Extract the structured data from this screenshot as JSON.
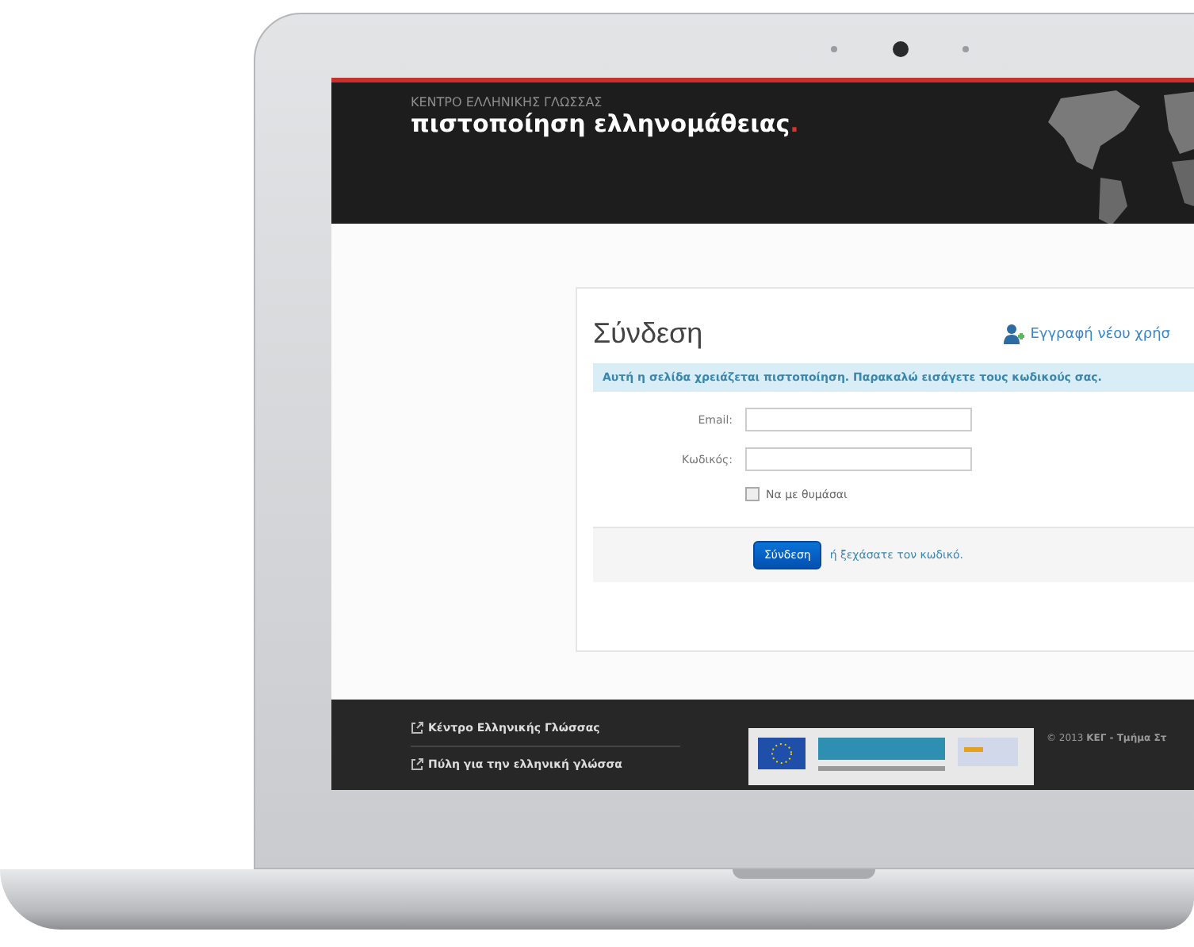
{
  "header": {
    "subtitle": "ΚΕΝΤΡΟ ΕΛΛΗΝΙΚΗΣ ΓΛΩΣΣΑΣ",
    "title": "πιστοποίηση ελληνομάθειας",
    "title_mark": "."
  },
  "login": {
    "heading": "Σύνδεση",
    "register_link": "Εγγραφή νέου χρήσ",
    "notice": "Αυτή η σελίδα χρειάζεται πιστοποίηση. Παρακαλώ εισάγετε τους κωδικούς σας.",
    "fields": [
      {
        "label": "Email:"
      },
      {
        "label": "Κωδικός:"
      }
    ],
    "remember": {
      "label": "Να με θυμάσαι",
      "checked": false
    },
    "submit": "Σύνδεση",
    "forgot_link": "ή ξεχάσατε τον κωδικό."
  },
  "footer": {
    "links": [
      "Κέντρο Ελληνικής Γλώσσας",
      "Πύλη για την ελληνική γλώσσα"
    ],
    "copyright": "© 2013 **ΚΕΓ - Τμήμα Στ**"
  }
}
